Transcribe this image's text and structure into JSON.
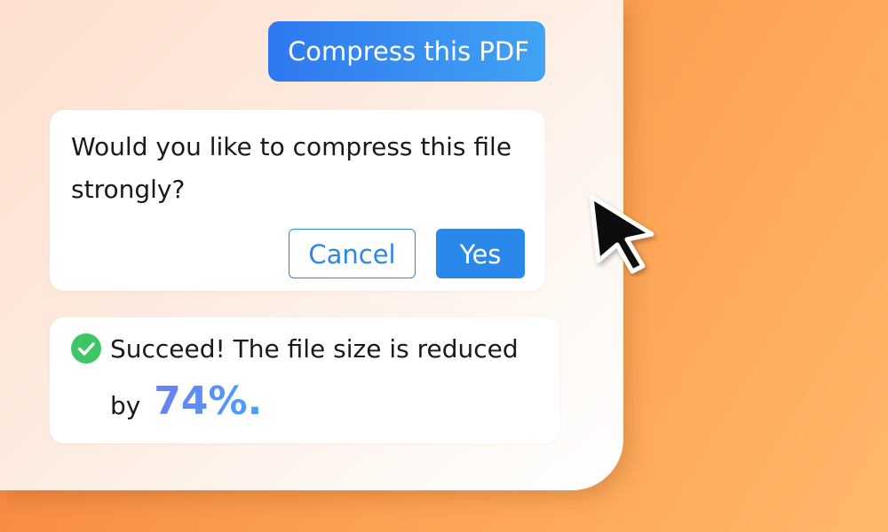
{
  "chat": {
    "user_message": "Compress this PDF",
    "question": {
      "text": "Would you like to compress this file strongly?",
      "cancel_label": "Cancel",
      "yes_label": "Yes"
    },
    "result": {
      "line1": "Succeed! The file size is reduced",
      "line2_prefix": "by",
      "percent": "74%."
    }
  },
  "colors": {
    "accent_blue": "#2a88ea",
    "success_green": "#3cc764",
    "background_orange": "#fb9a4c"
  },
  "icons": {
    "status": "check-circle-icon",
    "pointer": "mouse-cursor-icon"
  }
}
